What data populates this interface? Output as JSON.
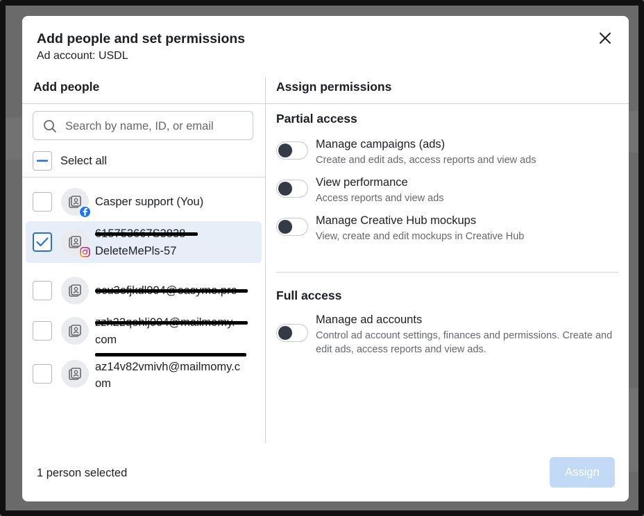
{
  "modal": {
    "title": "Add people and set permissions",
    "subtitle": "Ad account: USDL"
  },
  "left": {
    "heading": "Add people",
    "search_placeholder": "Search by name, ID, or email",
    "select_all_label": "Select all",
    "people": [
      {
        "line1": "Casper support (You)",
        "line2": "",
        "checked": false,
        "badge": "facebook-icon",
        "redacted": false
      },
      {
        "line1": "615753667S3838",
        "line2": "DeleteMePls-57",
        "checked": true,
        "badge": "instagram-icon",
        "redacted": true
      },
      {
        "line1": "ecu3efjkdl004@easymo.pro",
        "line2": "",
        "checked": false,
        "badge": "",
        "redacted": true
      },
      {
        "line1": "zzh22qohlj004@mailmomy.",
        "line2": "com",
        "checked": false,
        "badge": "",
        "redacted": true
      },
      {
        "line1": "az14v82vmivh@mailmomy.c",
        "line2": "om",
        "checked": false,
        "badge": "",
        "redacted": true
      }
    ]
  },
  "right": {
    "heading": "Assign permissions",
    "partial_title": "Partial access",
    "partial_permissions": [
      {
        "title": "Manage campaigns (ads)",
        "desc": "Create and edit ads, access reports and view ads",
        "enabled": false
      },
      {
        "title": "View performance",
        "desc": "Access reports and view ads",
        "enabled": false
      },
      {
        "title": "Manage Creative Hub mockups",
        "desc": "View, create and edit mockups in Creative Hub",
        "enabled": false
      }
    ],
    "full_title": "Full access",
    "full_permissions": [
      {
        "title": "Manage ad accounts",
        "desc": "Control ad account settings, finances and permissions. Create and edit ads, access reports and view ads.",
        "enabled": false
      }
    ]
  },
  "footer": {
    "selected_text": "1 person selected",
    "assign_label": "Assign"
  },
  "colors": {
    "accent": "#2a6fd6",
    "assign_disabled": "#c3daf7",
    "toggle_knob": "#343a46",
    "selected_row": "#e7eef8"
  }
}
